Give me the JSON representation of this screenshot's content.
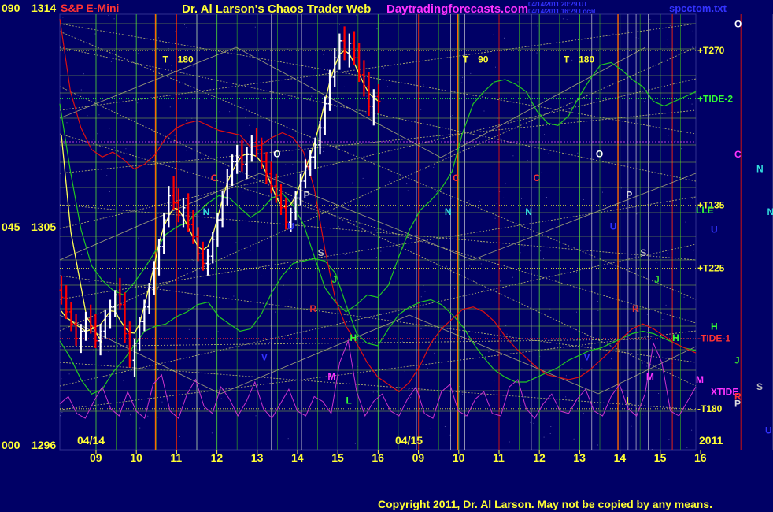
{
  "header": {
    "left_scale": "090",
    "left_price": "1314",
    "instrument": "S&P E-Mini",
    "title": "Dr. Al Larson's Chaos Trader Web",
    "website": "Daytradingforecasts.com",
    "file_name": "spcctom.txt",
    "timestamp_1": "04/14/2011 20:29 UT",
    "timestamp_2": "04/14/2011 16:29 Local"
  },
  "footer": {
    "copyright": "Copyright 2011, Dr. Al Larson. May not be copied by any means."
  },
  "colors": {
    "background": "#000066",
    "grid_green": "#2fa82f",
    "grid_yellow": "#c8c870",
    "bar_up": "#ffffff",
    "bar_down": "#ff0000",
    "tide_green": "#22c722",
    "tide_red": "#dd1111",
    "cycle_magenta": "#cc33cc",
    "label_yellow": "#ffff33",
    "label_cyan": "#33dddd",
    "label_magenta": "#ff33ff"
  },
  "chart_data": {
    "type": "bar",
    "title": "S&P E-Mini",
    "ylim": [
      1296,
      1314
    ],
    "y_ticks": [
      {
        "scale": "000",
        "price": "1296",
        "value": 1296
      },
      {
        "scale": "045",
        "price": "1305",
        "value": 1305
      },
      {
        "scale": "090",
        "price": "1314",
        "value": 1314
      }
    ],
    "x_hours": [
      "09",
      "10",
      "11",
      "12",
      "13",
      "14",
      "15",
      "16",
      "09",
      "10",
      "11",
      "12",
      "13",
      "14",
      "15",
      "16"
    ],
    "date_labels": [
      "04/14",
      "04/15"
    ],
    "year_label": "2011",
    "ohlc_bars": [
      [
        1302.6,
        1303.2,
        1302.0,
        1302.3
      ],
      [
        1302.3,
        1302.8,
        1301.4,
        1301.7
      ],
      [
        1301.7,
        1302.1,
        1300.9,
        1301.2
      ],
      [
        1301.2,
        1301.6,
        1300.3,
        1300.6
      ],
      [
        1300.6,
        1301.2,
        1300.0,
        1300.9
      ],
      [
        1300.9,
        1301.7,
        1300.5,
        1301.4
      ],
      [
        1301.4,
        1302.0,
        1300.8,
        1301.1
      ],
      [
        1301.1,
        1301.6,
        1300.2,
        1300.5
      ],
      [
        1300.5,
        1301.2,
        1299.9,
        1300.9
      ],
      [
        1300.9,
        1301.8,
        1300.6,
        1301.5
      ],
      [
        1301.5,
        1302.2,
        1301.0,
        1301.9
      ],
      [
        1301.9,
        1302.6,
        1301.5,
        1302.4
      ],
      [
        1302.4,
        1303.1,
        1301.8,
        1302.0
      ],
      [
        1302.0,
        1302.5,
        1300.4,
        1300.8
      ],
      [
        1300.8,
        1301.3,
        1299.4,
        1299.7
      ],
      [
        1299.7,
        1300.6,
        1299.0,
        1300.4
      ],
      [
        1300.4,
        1301.5,
        1300.1,
        1301.3
      ],
      [
        1301.3,
        1302.2,
        1300.9,
        1301.9
      ],
      [
        1301.9,
        1302.9,
        1301.6,
        1302.7
      ],
      [
        1302.7,
        1303.8,
        1302.4,
        1303.5
      ],
      [
        1303.5,
        1304.7,
        1303.2,
        1304.4
      ],
      [
        1304.4,
        1305.8,
        1304.1,
        1305.5
      ],
      [
        1305.5,
        1306.9,
        1305.2,
        1306.5
      ],
      [
        1306.5,
        1307.3,
        1305.9,
        1306.2
      ],
      [
        1306.2,
        1306.8,
        1305.4,
        1305.7
      ],
      [
        1305.7,
        1306.4,
        1305.2,
        1306.0
      ],
      [
        1306.0,
        1306.6,
        1305.0,
        1305.3
      ],
      [
        1305.3,
        1305.9,
        1304.5,
        1304.8
      ],
      [
        1304.8,
        1305.2,
        1303.8,
        1304.1
      ],
      [
        1304.1,
        1304.6,
        1303.4,
        1303.7
      ],
      [
        1303.7,
        1304.3,
        1303.2,
        1304.0
      ],
      [
        1304.0,
        1305.0,
        1303.7,
        1304.7
      ],
      [
        1304.7,
        1305.8,
        1304.4,
        1305.5
      ],
      [
        1305.5,
        1306.7,
        1305.2,
        1306.4
      ],
      [
        1306.4,
        1307.6,
        1306.1,
        1307.3
      ],
      [
        1307.3,
        1308.2,
        1306.9,
        1307.9
      ],
      [
        1307.9,
        1308.6,
        1307.4,
        1308.1
      ],
      [
        1308.1,
        1308.8,
        1307.5,
        1307.8
      ],
      [
        1307.8,
        1308.5,
        1307.2,
        1308.2
      ],
      [
        1308.2,
        1309.0,
        1307.9,
        1308.7
      ],
      [
        1308.7,
        1309.3,
        1308.1,
        1308.4
      ],
      [
        1308.4,
        1308.9,
        1307.6,
        1307.9
      ],
      [
        1307.9,
        1308.3,
        1307.0,
        1307.4
      ],
      [
        1307.4,
        1307.9,
        1306.6,
        1306.9
      ],
      [
        1306.9,
        1307.4,
        1306.2,
        1306.5
      ],
      [
        1306.5,
        1307.0,
        1305.7,
        1306.0
      ],
      [
        1306.0,
        1306.4,
        1305.1,
        1305.4
      ],
      [
        1305.4,
        1306.0,
        1305.0,
        1305.8
      ],
      [
        1305.8,
        1306.7,
        1305.5,
        1306.4
      ],
      [
        1306.4,
        1307.4,
        1306.1,
        1307.1
      ],
      [
        1307.1,
        1308.0,
        1306.8,
        1307.7
      ],
      [
        1307.7,
        1308.4,
        1307.3,
        1308.1
      ],
      [
        1308.1,
        1308.9,
        1307.6,
        1308.6
      ],
      [
        1308.6,
        1309.6,
        1308.2,
        1309.3
      ],
      [
        1309.3,
        1310.6,
        1309.0,
        1310.3
      ],
      [
        1310.3,
        1311.7,
        1310.0,
        1311.4
      ],
      [
        1311.4,
        1312.6,
        1311.0,
        1312.2
      ],
      [
        1312.2,
        1313.2,
        1311.7,
        1312.9
      ],
      [
        1312.9,
        1313.5,
        1312.1,
        1312.4
      ],
      [
        1312.4,
        1313.2,
        1311.8,
        1312.8
      ],
      [
        1312.8,
        1313.3,
        1311.9,
        1312.2
      ],
      [
        1312.2,
        1312.8,
        1311.2,
        1311.5
      ],
      [
        1311.5,
        1312.1,
        1310.6,
        1311.0
      ],
      [
        1311.0,
        1311.6,
        1309.8,
        1310.2
      ],
      [
        1310.2,
        1310.9,
        1309.4,
        1310.6
      ],
      [
        1310.6,
        1311.1,
        1309.9,
        1310.4
      ]
    ],
    "h_lines": [
      {
        "value": 1312.5,
        "label": "+T270",
        "color": "#ffff33"
      },
      {
        "value": 1310.5,
        "label": "+TIDE-2",
        "color": "#33ff33"
      },
      {
        "value": 1306.1,
        "label": "+T135",
        "color": "#ffff33"
      },
      {
        "value": 1303.5,
        "label": "+T225",
        "color": "#ffff33"
      },
      {
        "value": 1300.6,
        "label": "-TIDE-1",
        "color": "#ff3333"
      },
      {
        "value": 1297.7,
        "label": "-T180",
        "color": "#ffff33"
      }
    ],
    "tide_series": [
      {
        "color": "#22c722",
        "width": 1.2,
        "values": [
          1310.3,
          1307.5,
          1305.1,
          1303.6,
          1303.0,
          1302.6,
          1302.4,
          1302.9,
          1303.5,
          1304.2,
          1304.9,
          1305.2,
          1305.4,
          1305.8,
          1306.2,
          1306.5,
          1306.4,
          1306.0,
          1305.6,
          1305.9,
          1306.4,
          1306.6,
          1306.1,
          1305.3,
          1304.0,
          1302.7,
          1302.1,
          1301.7,
          1302.0,
          1302.4,
          1302.3,
          1302.8,
          1304.0,
          1305.1,
          1305.9,
          1306.3,
          1306.8,
          1307.5,
          1309.1,
          1310.3,
          1310.8,
          1311.2,
          1311.3,
          1311.1,
          1310.8,
          1310.0,
          1309.5,
          1309.4,
          1309.8,
          1310.6,
          1311.3,
          1311.9,
          1312.0,
          1311.7,
          1311.3,
          1311.0,
          1310.4,
          1310.2,
          1310.4,
          1310.6,
          1310.8
        ]
      },
      {
        "color": "#22c722",
        "width": 1.2,
        "values": [
          1300.5,
          1299.8,
          1298.9,
          1298.3,
          1298.5,
          1299.2,
          1299.7,
          1300.3,
          1300.9,
          1301.1,
          1301.2,
          1301.5,
          1301.7,
          1302.0,
          1302.1,
          1301.5,
          1301.2,
          1300.9,
          1301.0,
          1301.6,
          1302.5,
          1303.2,
          1303.7,
          1303.8,
          1303.9,
          1303.8,
          1303.3,
          1302.0,
          1300.8,
          1300.4,
          1300.3,
          1301.0,
          1301.6,
          1301.9,
          1302.1,
          1302.2,
          1302.0,
          1301.6,
          1301.1,
          1300.4,
          1299.8,
          1299.3,
          1299.0,
          1298.8,
          1298.8,
          1299.0,
          1299.2,
          1299.4,
          1299.7,
          1299.9,
          1300.1,
          1300.2,
          1300.4,
          1300.6,
          1300.8,
          1300.9,
          1300.8,
          1300.6,
          1300.4,
          1300.2,
          1300.1
        ]
      },
      {
        "color": "#dd1111",
        "width": 1.2,
        "values": [
          1313.8,
          1310.8,
          1309.3,
          1308.4,
          1308.1,
          1308.3,
          1308.0,
          1307.6,
          1307.8,
          1308.2,
          1308.9,
          1309.3,
          1309.5,
          1309.6,
          1309.4,
          1309.2,
          1309.1,
          1309.0,
          1308.5,
          1308.6,
          1308.9,
          1309.1,
          1308.9,
          1308.3,
          1306.8,
          1304.3,
          1302.2,
          1301.1,
          1300.4,
          1299.6,
          1299.0,
          1298.7,
          1298.4,
          1298.8,
          1299.5,
          1300.4,
          1301.0,
          1301.4,
          1301.8,
          1301.9,
          1301.7,
          1301.3,
          1300.7,
          1300.2,
          1299.8,
          1299.4,
          1299.1,
          1299.0,
          1298.9,
          1299.0,
          1299.3,
          1299.7,
          1300.1,
          1300.6,
          1301.0,
          1301.2,
          1301.0,
          1300.7,
          1300.4,
          1300.2,
          1300.0
        ]
      }
    ],
    "cycle_series": {
      "color": "#cc33cc",
      "base": 1297.8,
      "values": [
        1297.9,
        1298.2,
        1297.5,
        1297.3,
        1298.0,
        1298.6,
        1297.7,
        1297.4,
        1298.4,
        1297.6,
        1297.3,
        1298.7,
        1299.1,
        1297.6,
        1297.3,
        1298.3,
        1298.9,
        1297.8,
        1297.5,
        1298.6,
        1298.1,
        1297.4,
        1298.0,
        1298.8,
        1297.7,
        1297.3,
        1297.9,
        1298.5,
        1297.6,
        1297.4,
        1298.2,
        1298.0,
        1297.5,
        1299.6,
        1300.5,
        1298.4,
        1297.4,
        1298.0,
        1298.3,
        1297.6,
        1297.4,
        1298.1,
        1298.6,
        1297.5,
        1297.3,
        1298.4,
        1298.7,
        1297.6,
        1297.4,
        1298.1,
        1298.4,
        1297.5,
        1297.4,
        1298.6,
        1298.9,
        1297.7,
        1297.3,
        1297.9,
        1298.3,
        1297.6,
        1297.5,
        1298.1,
        1298.5,
        1297.6,
        1297.4,
        1298.2,
        1298.7,
        1297.7,
        1297.4,
        1298.3,
        1300.4,
        1299.6,
        1297.6,
        1297.4,
        1298.0,
        1298.6
      ]
    },
    "markers": [
      {
        "text": "T",
        "slot": 3.3,
        "value": 1312.0,
        "color": "#ffff33"
      },
      {
        "text": "180",
        "slot": 4.05,
        "value": 1312.0,
        "color": "#ffff33"
      },
      {
        "text": "T",
        "slot": 18.2,
        "value": 1312.0,
        "color": "#ffff33"
      },
      {
        "text": "90",
        "slot": 18.95,
        "value": 1312.0,
        "color": "#ffff33"
      },
      {
        "text": "T",
        "slot": 23.2,
        "value": 1312.0,
        "color": "#ffff33"
      },
      {
        "text": "180",
        "slot": 23.95,
        "value": 1312.0,
        "color": "#ffff33"
      },
      {
        "text": "O",
        "slot": 8.8,
        "value": 1308.1,
        "color": "#ffffff"
      },
      {
        "text": "O",
        "slot": 24.8,
        "value": 1308.1,
        "color": "#ffffff"
      },
      {
        "text": "C",
        "slot": 5.7,
        "value": 1307.1,
        "color": "#ff3333"
      },
      {
        "text": "C",
        "slot": 17.7,
        "value": 1307.1,
        "color": "#ff3333"
      },
      {
        "text": "C",
        "slot": 21.7,
        "value": 1307.1,
        "color": "#ff3333"
      },
      {
        "text": "C",
        "slot": 33.7,
        "value": 1307.1,
        "color": "#ff3333"
      },
      {
        "text": "N",
        "slot": 5.3,
        "value": 1305.7,
        "color": "#33dddd"
      },
      {
        "text": "N",
        "slot": 17.3,
        "value": 1305.7,
        "color": "#33dddd"
      },
      {
        "text": "N",
        "slot": 21.3,
        "value": 1305.7,
        "color": "#33dddd"
      },
      {
        "text": "N",
        "slot": 33.3,
        "value": 1305.7,
        "color": "#33dddd"
      },
      {
        "text": "P",
        "slot": 10.3,
        "value": 1306.4,
        "color": "#dddddd"
      },
      {
        "text": "P",
        "slot": 26.3,
        "value": 1306.4,
        "color": "#dddddd"
      },
      {
        "text": "U",
        "slot": 9.5,
        "value": 1305.1,
        "color": "#3333ff"
      },
      {
        "text": "U",
        "slot": 25.5,
        "value": 1305.1,
        "color": "#3333ff"
      },
      {
        "text": "S",
        "slot": 11.0,
        "value": 1304.0,
        "color": "#bbbbbb"
      },
      {
        "text": "S",
        "slot": 27.0,
        "value": 1304.0,
        "color": "#bbbbbb"
      },
      {
        "text": "J",
        "slot": 11.7,
        "value": 1302.9,
        "color": "#33cc33"
      },
      {
        "text": "J",
        "slot": 27.7,
        "value": 1302.9,
        "color": "#33cc33"
      },
      {
        "text": "R",
        "slot": 10.6,
        "value": 1301.7,
        "color": "#dd3333"
      },
      {
        "text": "R",
        "slot": 26.6,
        "value": 1301.7,
        "color": "#dd3333"
      },
      {
        "text": "H",
        "slot": 12.6,
        "value": 1300.5,
        "color": "#33ff33"
      },
      {
        "text": "H",
        "slot": 28.6,
        "value": 1300.5,
        "color": "#33ff33"
      },
      {
        "text": "V",
        "slot": 8.2,
        "value": 1299.7,
        "color": "#3333ff"
      },
      {
        "text": "V",
        "slot": 24.2,
        "value": 1299.7,
        "color": "#3333ff"
      },
      {
        "text": "M",
        "slot": 11.5,
        "value": 1298.9,
        "color": "#ff33ff"
      },
      {
        "text": "M",
        "slot": 27.3,
        "value": 1298.9,
        "color": "#ff33ff"
      },
      {
        "text": "L",
        "slot": 12.4,
        "value": 1297.9,
        "color": "#33ff33"
      },
      {
        "text": "L",
        "slot": 26.3,
        "value": 1297.9,
        "color": "#ffff33"
      }
    ],
    "right_labels": [
      {
        "text": "O",
        "value": 1313.6,
        "color": "#ffffff",
        "col": 2
      },
      {
        "text": "C",
        "value": 1308.2,
        "color": "#ff33ff",
        "col": 2
      },
      {
        "text": "N",
        "value": 1307.6,
        "color": "#33dddd",
        "col": 3
      },
      {
        "text": "LLE",
        "value": 1305.9,
        "color": "#33ff33",
        "col": 0
      },
      {
        "text": "U",
        "value": 1305.1,
        "color": "#3333ff",
        "col": 1
      },
      {
        "text": "H",
        "value": 1301.1,
        "color": "#33ff33",
        "col": 1
      },
      {
        "text": "J",
        "value": 1299.7,
        "color": "#33cc33",
        "col": 2
      },
      {
        "text": "M",
        "value": 1298.9,
        "color": "#ff33ff",
        "col": 0
      },
      {
        "text": "XTIDE",
        "value": 1298.4,
        "color": "#ff33ff",
        "col": 1
      },
      {
        "text": "S",
        "value": 1298.6,
        "color": "#bbbbbb",
        "col": 3
      },
      {
        "text": "R",
        "value": 1298.2,
        "color": "#ff3333",
        "col": 2
      },
      {
        "text": "P",
        "value": 1297.9,
        "color": "#dddddd",
        "col": 2
      },
      {
        "text": "U",
        "value": 1296.8,
        "color": "#3333ff",
        "col": 4
      }
    ]
  }
}
